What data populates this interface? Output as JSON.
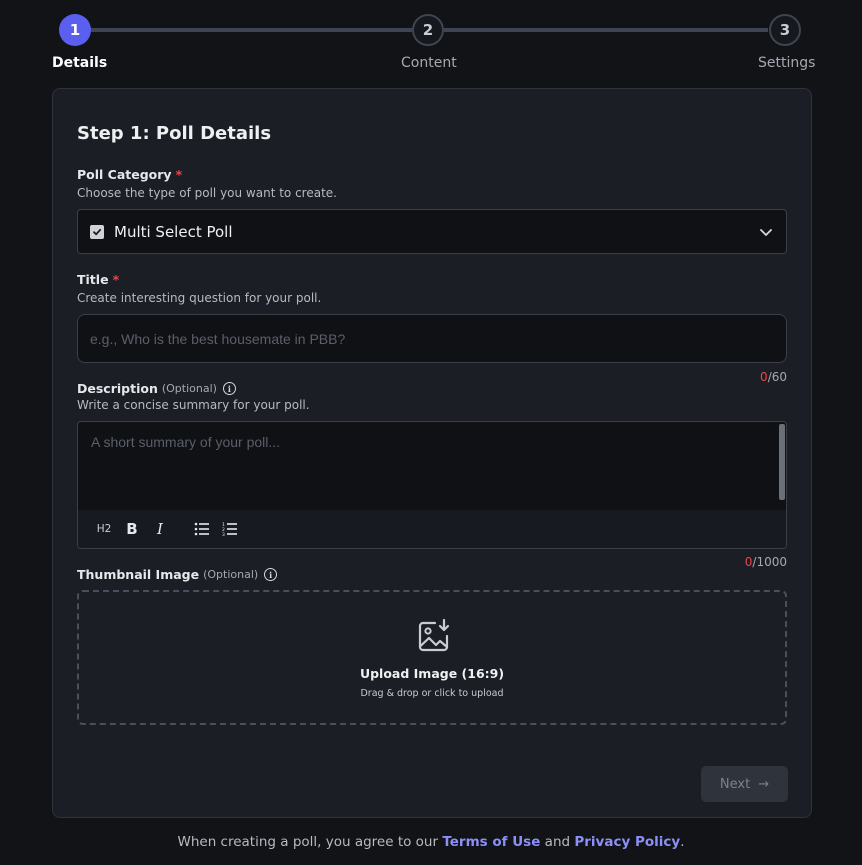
{
  "stepper": {
    "steps": [
      {
        "number": "1",
        "label": "Details",
        "state": "active"
      },
      {
        "number": "2",
        "label": "Content",
        "state": "inactive"
      },
      {
        "number": "3",
        "label": "Settings",
        "state": "inactive"
      }
    ]
  },
  "form": {
    "title": "Step 1: Poll Details",
    "category": {
      "label": "Poll Category",
      "required_mark": "*",
      "help": "Choose the type of poll you want to create.",
      "selected": "Multi Select Poll",
      "icon": "checkbox-icon"
    },
    "title_field": {
      "label": "Title",
      "required_mark": "*",
      "help": "Create interesting question for your poll.",
      "placeholder": "e.g., Who is the best housemate in PBB?",
      "value": "",
      "count_current": "0",
      "count_max": "/60"
    },
    "description": {
      "label": "Description",
      "optional": "(Optional)",
      "help": "Write a concise summary for your poll.",
      "placeholder": "A short summary of your poll...",
      "toolbar": {
        "h2": "H2",
        "bold": "B",
        "italic": "I"
      },
      "count_current": "0",
      "count_max": "/1000"
    },
    "thumbnail": {
      "label": "Thumbnail Image",
      "optional": "(Optional)",
      "upload_title": "Upload Image (16:9)",
      "upload_sub": "Drag & drop or click to upload"
    },
    "next_label": "Next",
    "next_arrow": "→"
  },
  "footer": {
    "prefix": "When creating a poll, you agree to our ",
    "terms": "Terms of Use",
    "and": " and ",
    "privacy": "Privacy Policy",
    "suffix": "."
  },
  "colors": {
    "accent": "#5b5ff0",
    "required": "#ef4444",
    "link": "#8b8ff7"
  }
}
